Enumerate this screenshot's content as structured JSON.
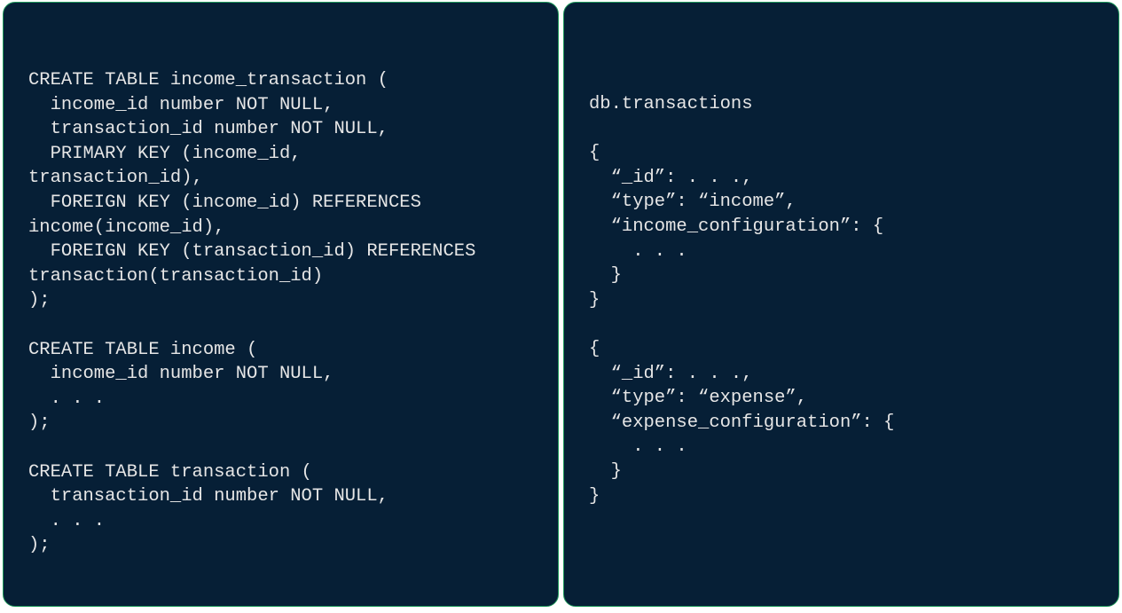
{
  "sql_panel": {
    "lines": [
      "CREATE TABLE income_transaction (",
      "  income_id number NOT NULL,",
      "  transaction_id number NOT NULL,",
      "  PRIMARY KEY (income_id,",
      "transaction_id),",
      "  FOREIGN KEY (income_id) REFERENCES",
      "income(income_id),",
      "  FOREIGN KEY (transaction_id) REFERENCES",
      "transaction(transaction_id)",
      ");",
      "",
      "CREATE TABLE income (",
      "  income_id number NOT NULL,",
      "  . . .",
      ");",
      "",
      "CREATE TABLE transaction (",
      "  transaction_id number NOT NULL,",
      "  . . .",
      ");"
    ]
  },
  "mongo_panel": {
    "lines": [
      "db.transactions",
      "",
      "{",
      "  “_id”: . . .,",
      "  “type”: “income”,",
      "  “income_configuration”: {",
      "    . . .",
      "  }",
      "}",
      "",
      "{",
      "  “_id”: . . .,",
      "  “type”: “expense”,",
      "  “expense_configuration”: {",
      "    . . .",
      "  }",
      "}"
    ]
  },
  "colors": {
    "panel_bg": "#061f36",
    "panel_border": "#1f9a5c",
    "text": "#e6e6e6"
  }
}
